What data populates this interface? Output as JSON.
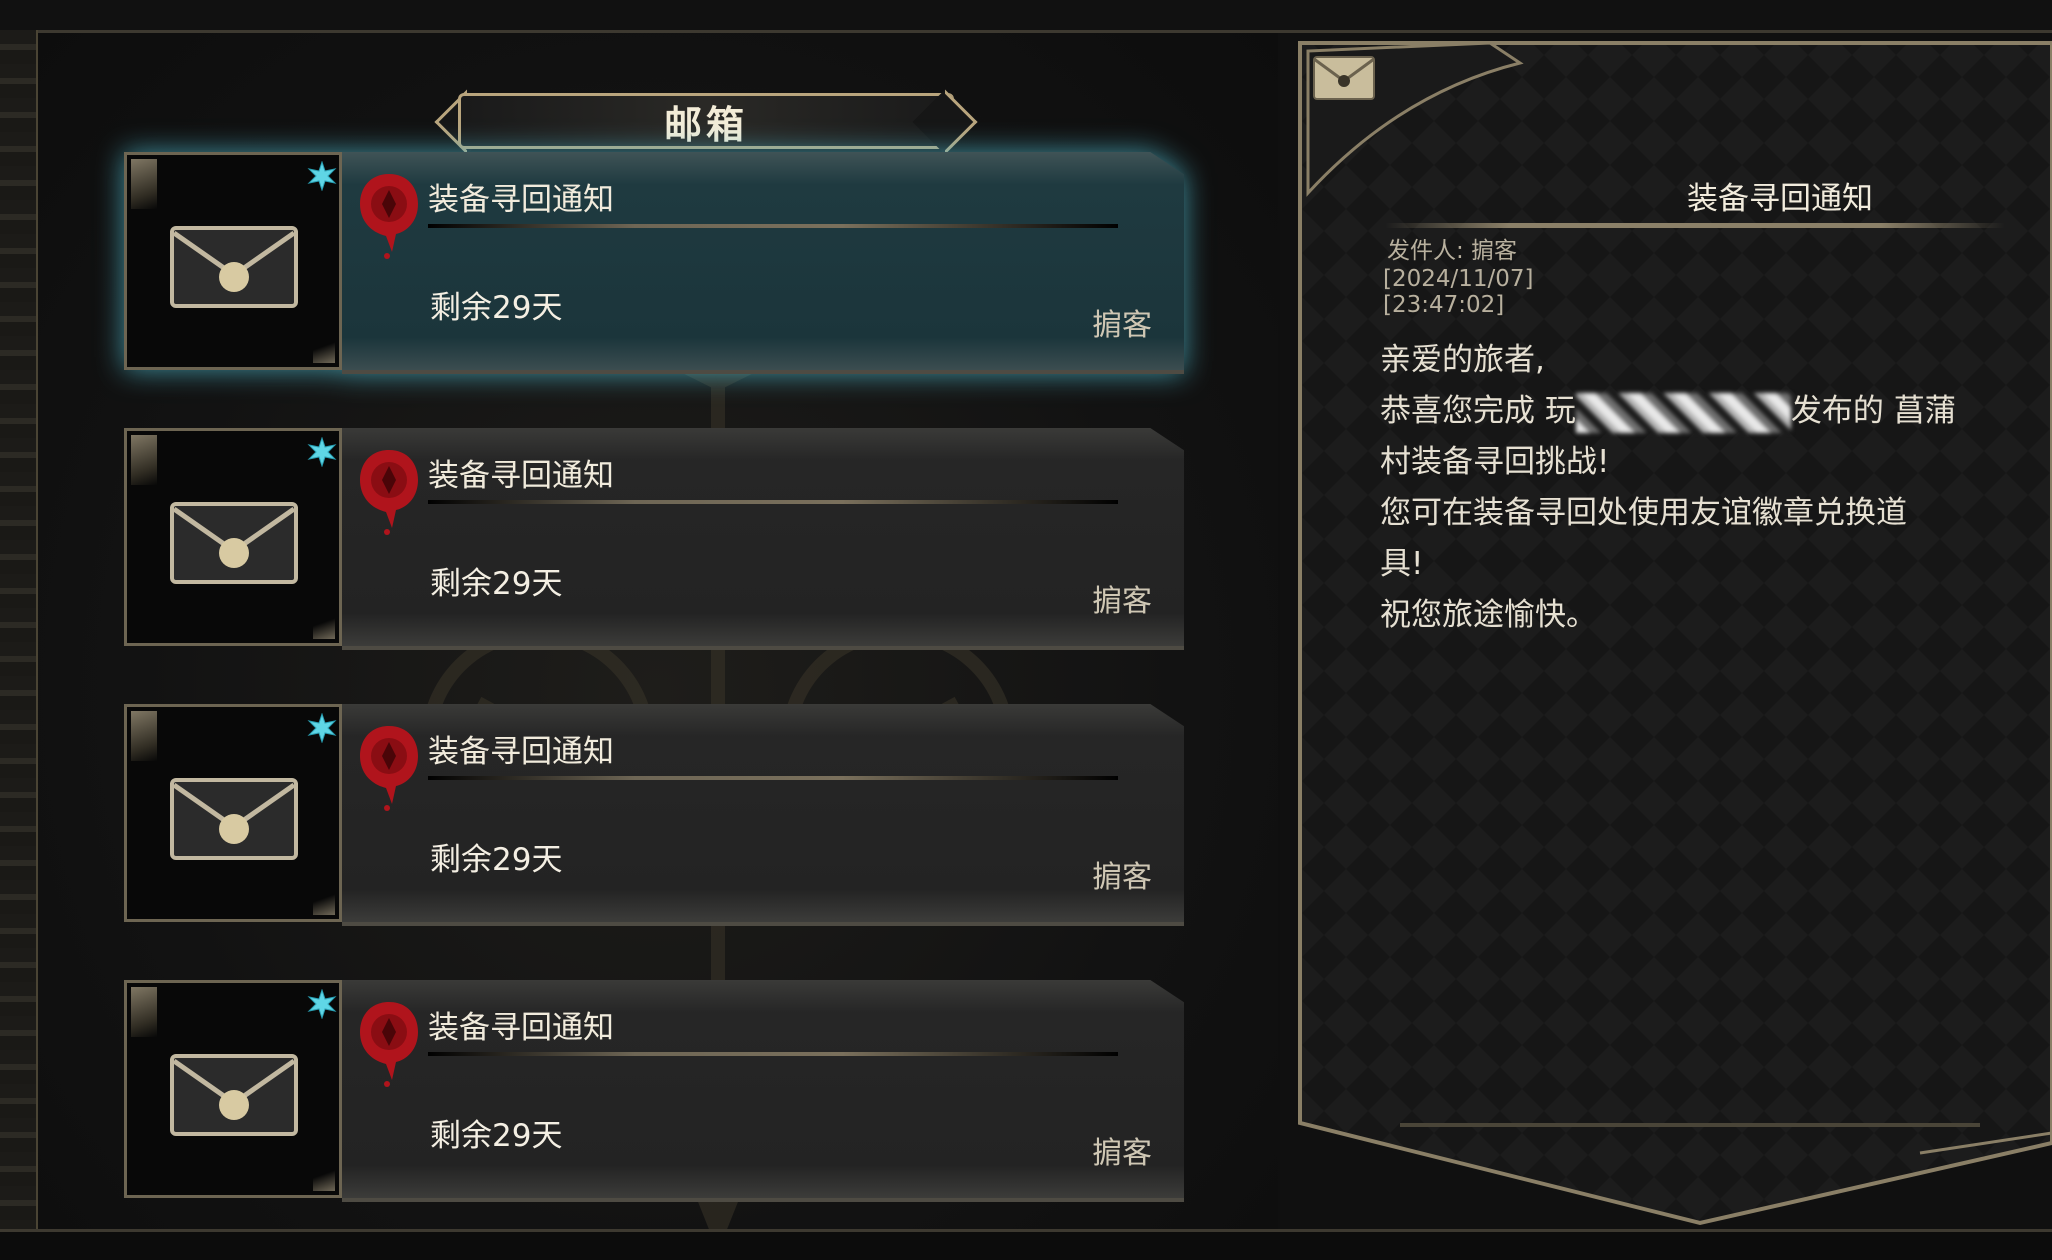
{
  "mailbox": {
    "title": "邮箱",
    "items": [
      {
        "subject": "装备寻回通知",
        "remaining": "剩余29天",
        "sender": "掮客",
        "selected": true
      },
      {
        "subject": "装备寻回通知",
        "remaining": "剩余29天",
        "sender": "掮客",
        "selected": false
      },
      {
        "subject": "装备寻回通知",
        "remaining": "剩余29天",
        "sender": "掮客",
        "selected": false
      },
      {
        "subject": "装备寻回通知",
        "remaining": "剩余29天",
        "sender": "掮客",
        "selected": false
      }
    ]
  },
  "detail": {
    "title": "装备寻回通知",
    "from": "发件人: 掮客",
    "date": "[2024/11/07]",
    "time": "[23:47:02]",
    "greeting": "亲爱的旅者,",
    "line2_prefix": "恭喜您完成 玩",
    "line2_suffix": "发布的 菖蒲",
    "line3": "村装备寻回挑战!",
    "line4": "您可在装备寻回处使用友谊徽章兑换道",
    "line5": "具!",
    "line6": "祝您旅途愉快。"
  },
  "colors": {
    "accent_gold": "#b9a57d",
    "selected_glow": "#50bed2",
    "seal_red": "#b0141c",
    "gem_cyan": "#5fd6e6"
  },
  "icons": {
    "thumb": "envelope-icon",
    "seal": "wax-seal-icon",
    "gem": "gem-icon",
    "detail": "envelope-icon"
  }
}
